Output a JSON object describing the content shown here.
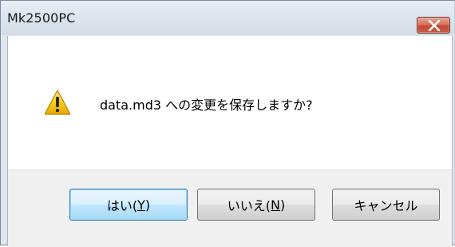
{
  "window": {
    "title": "Mk2500PC"
  },
  "dialog": {
    "icon": "warning-icon",
    "message": "data.md3 への変更を保存しますか?"
  },
  "buttons": {
    "yes": {
      "prefix": "はい(",
      "accel": "Y",
      "suffix": ")"
    },
    "no": {
      "prefix": "いいえ(",
      "accel": "N",
      "suffix": ")"
    },
    "cancel": {
      "label": "キャンセル"
    }
  },
  "colors": {
    "close_button": "#c85b44",
    "default_button_border": "#3c7fb1",
    "warning_yellow": "#f5c400"
  }
}
